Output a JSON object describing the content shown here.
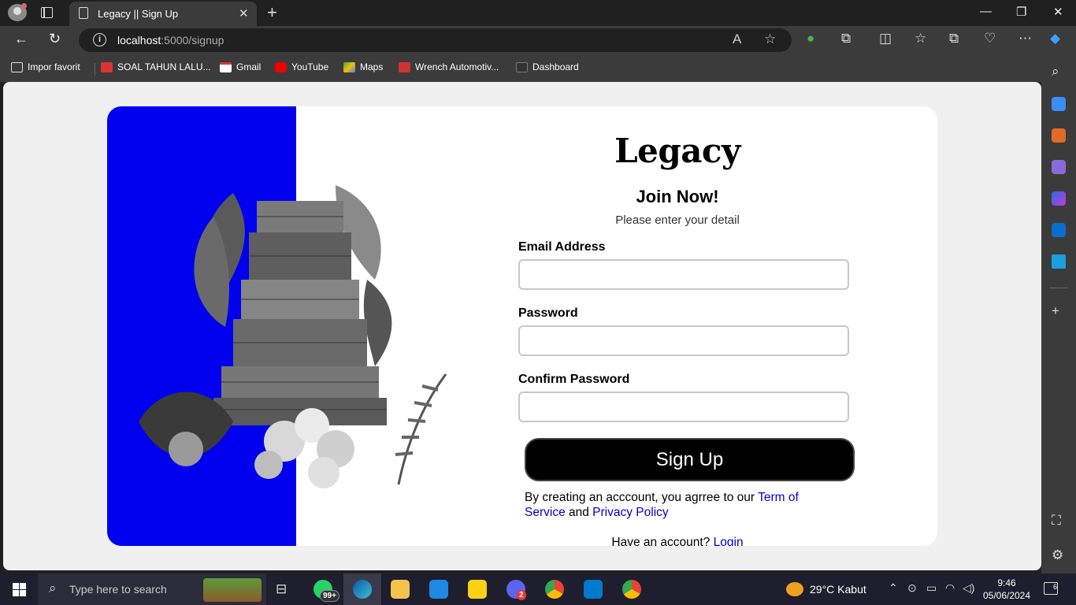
{
  "browser": {
    "tab_title": "Legacy || Sign Up",
    "url_host": "localhost",
    "url_path": ":5000/signup",
    "bookmarks": [
      "Impor favorit",
      "SOAL TAHUN LALU...",
      "Gmail",
      "YouTube",
      "Maps",
      "Wrench Automotiv...",
      "Dashboard"
    ]
  },
  "page": {
    "logo": "Legacy",
    "heading": "Join Now!",
    "subtitle": "Please enter your detail",
    "email_label": "Email Address",
    "password_label": "Password",
    "confirm_label": "Confirm Password",
    "signup_button": "Sign Up",
    "terms_prefix": "By creating an acccount, you agrree to our ",
    "terms_link": "Term of Service",
    "terms_and": " and ",
    "privacy_link": "Privacy Policy",
    "have_account": "Have an account? ",
    "login_link": "Login",
    "accent_color": "#0000ee"
  },
  "taskbar": {
    "search_placeholder": "Type here to search",
    "whatsapp_badge": "99+",
    "discord_badge": "2",
    "weather": "29°C  Kabut",
    "time": "9:46",
    "date": "05/06/2024",
    "notifications": "6"
  }
}
